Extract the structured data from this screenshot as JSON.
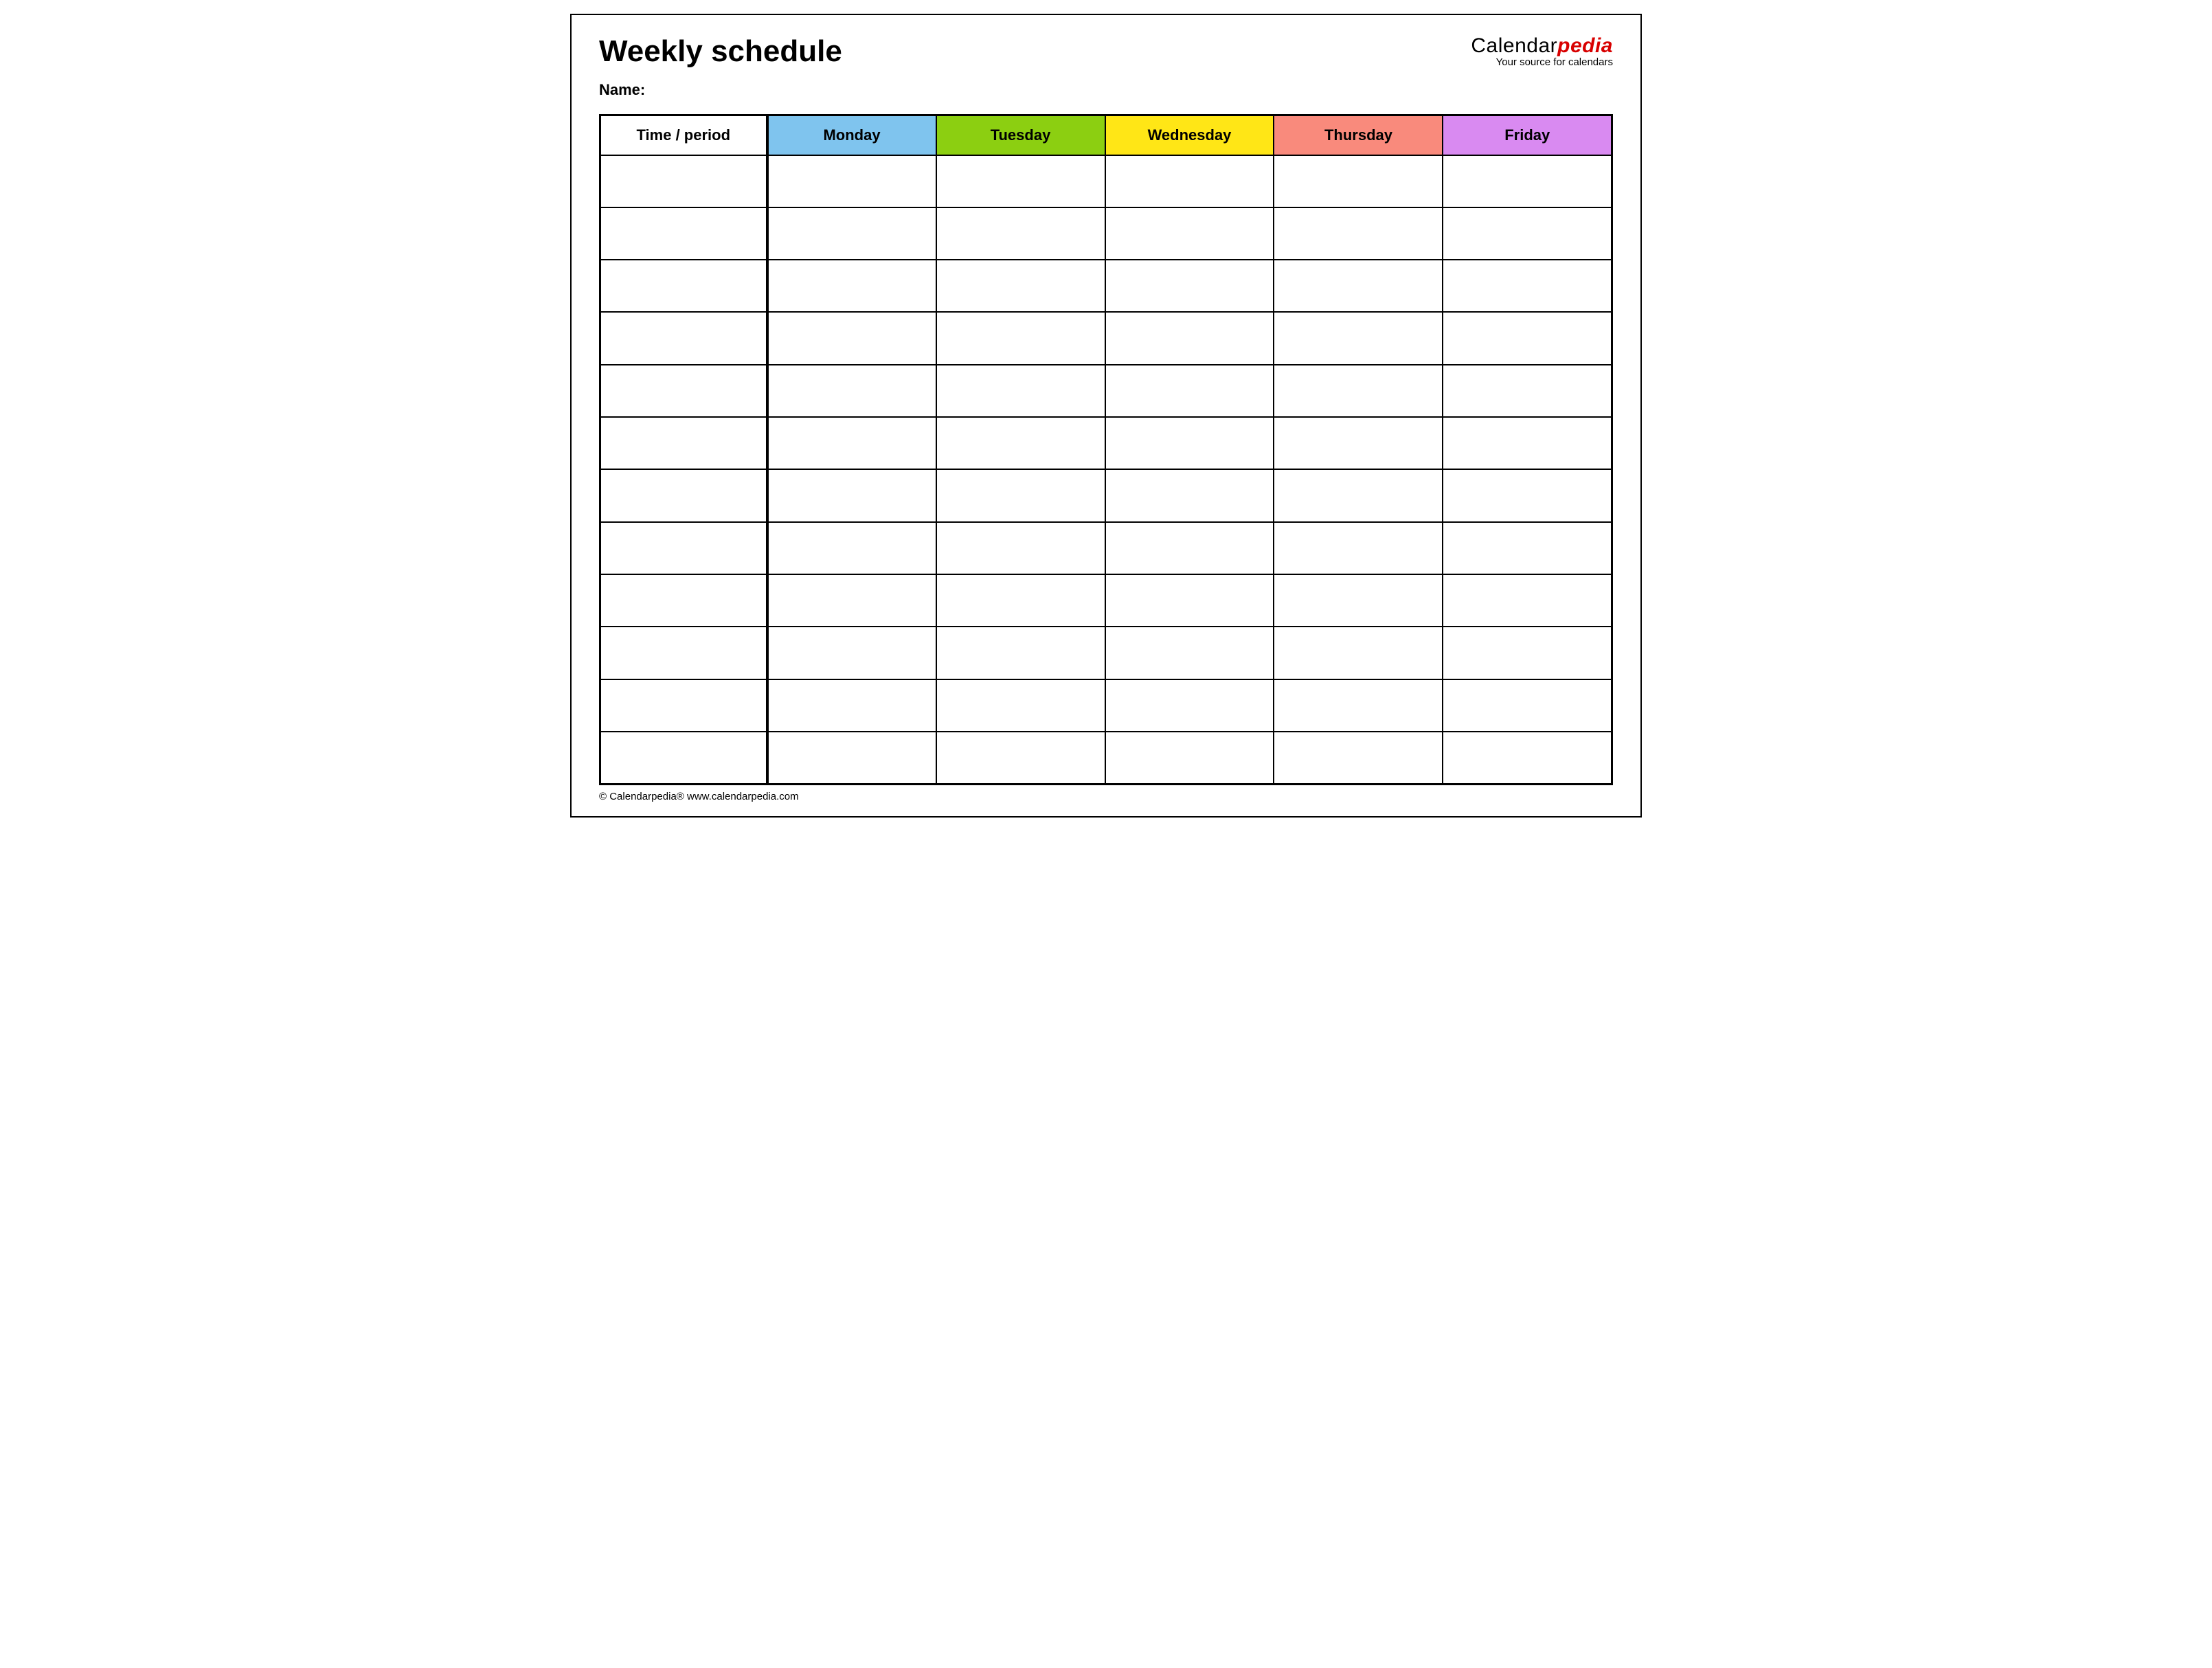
{
  "title": "Weekly schedule",
  "name_label": "Name:",
  "logo": {
    "prefix": "Calendar",
    "suffix": "pedia",
    "tagline": "Your source for calendars"
  },
  "columns": {
    "time": "Time / period",
    "days": [
      "Monday",
      "Tuesday",
      "Wednesday",
      "Thursday",
      "Friday"
    ]
  },
  "colors": {
    "monday": "#7fc4ee",
    "tuesday": "#8ccf11",
    "wednesday": "#ffe616",
    "thursday": "#f98a7c",
    "friday": "#d98af1"
  },
  "rows": [
    {
      "time": "",
      "cells": [
        "",
        "",
        "",
        "",
        ""
      ]
    },
    {
      "time": "",
      "cells": [
        "",
        "",
        "",
        "",
        ""
      ]
    },
    {
      "time": "",
      "cells": [
        "",
        "",
        "",
        "",
        ""
      ]
    },
    {
      "time": "",
      "cells": [
        "",
        "",
        "",
        "",
        ""
      ]
    },
    {
      "time": "",
      "cells": [
        "",
        "",
        "",
        "",
        ""
      ]
    },
    {
      "time": "",
      "cells": [
        "",
        "",
        "",
        "",
        ""
      ]
    },
    {
      "time": "",
      "cells": [
        "",
        "",
        "",
        "",
        ""
      ]
    },
    {
      "time": "",
      "cells": [
        "",
        "",
        "",
        "",
        ""
      ]
    },
    {
      "time": "",
      "cells": [
        "",
        "",
        "",
        "",
        ""
      ]
    },
    {
      "time": "",
      "cells": [
        "",
        "",
        "",
        "",
        ""
      ]
    },
    {
      "time": "",
      "cells": [
        "",
        "",
        "",
        "",
        ""
      ]
    },
    {
      "time": "",
      "cells": [
        "",
        "",
        "",
        "",
        ""
      ]
    }
  ],
  "footer": "© Calendarpedia®   www.calendarpedia.com"
}
